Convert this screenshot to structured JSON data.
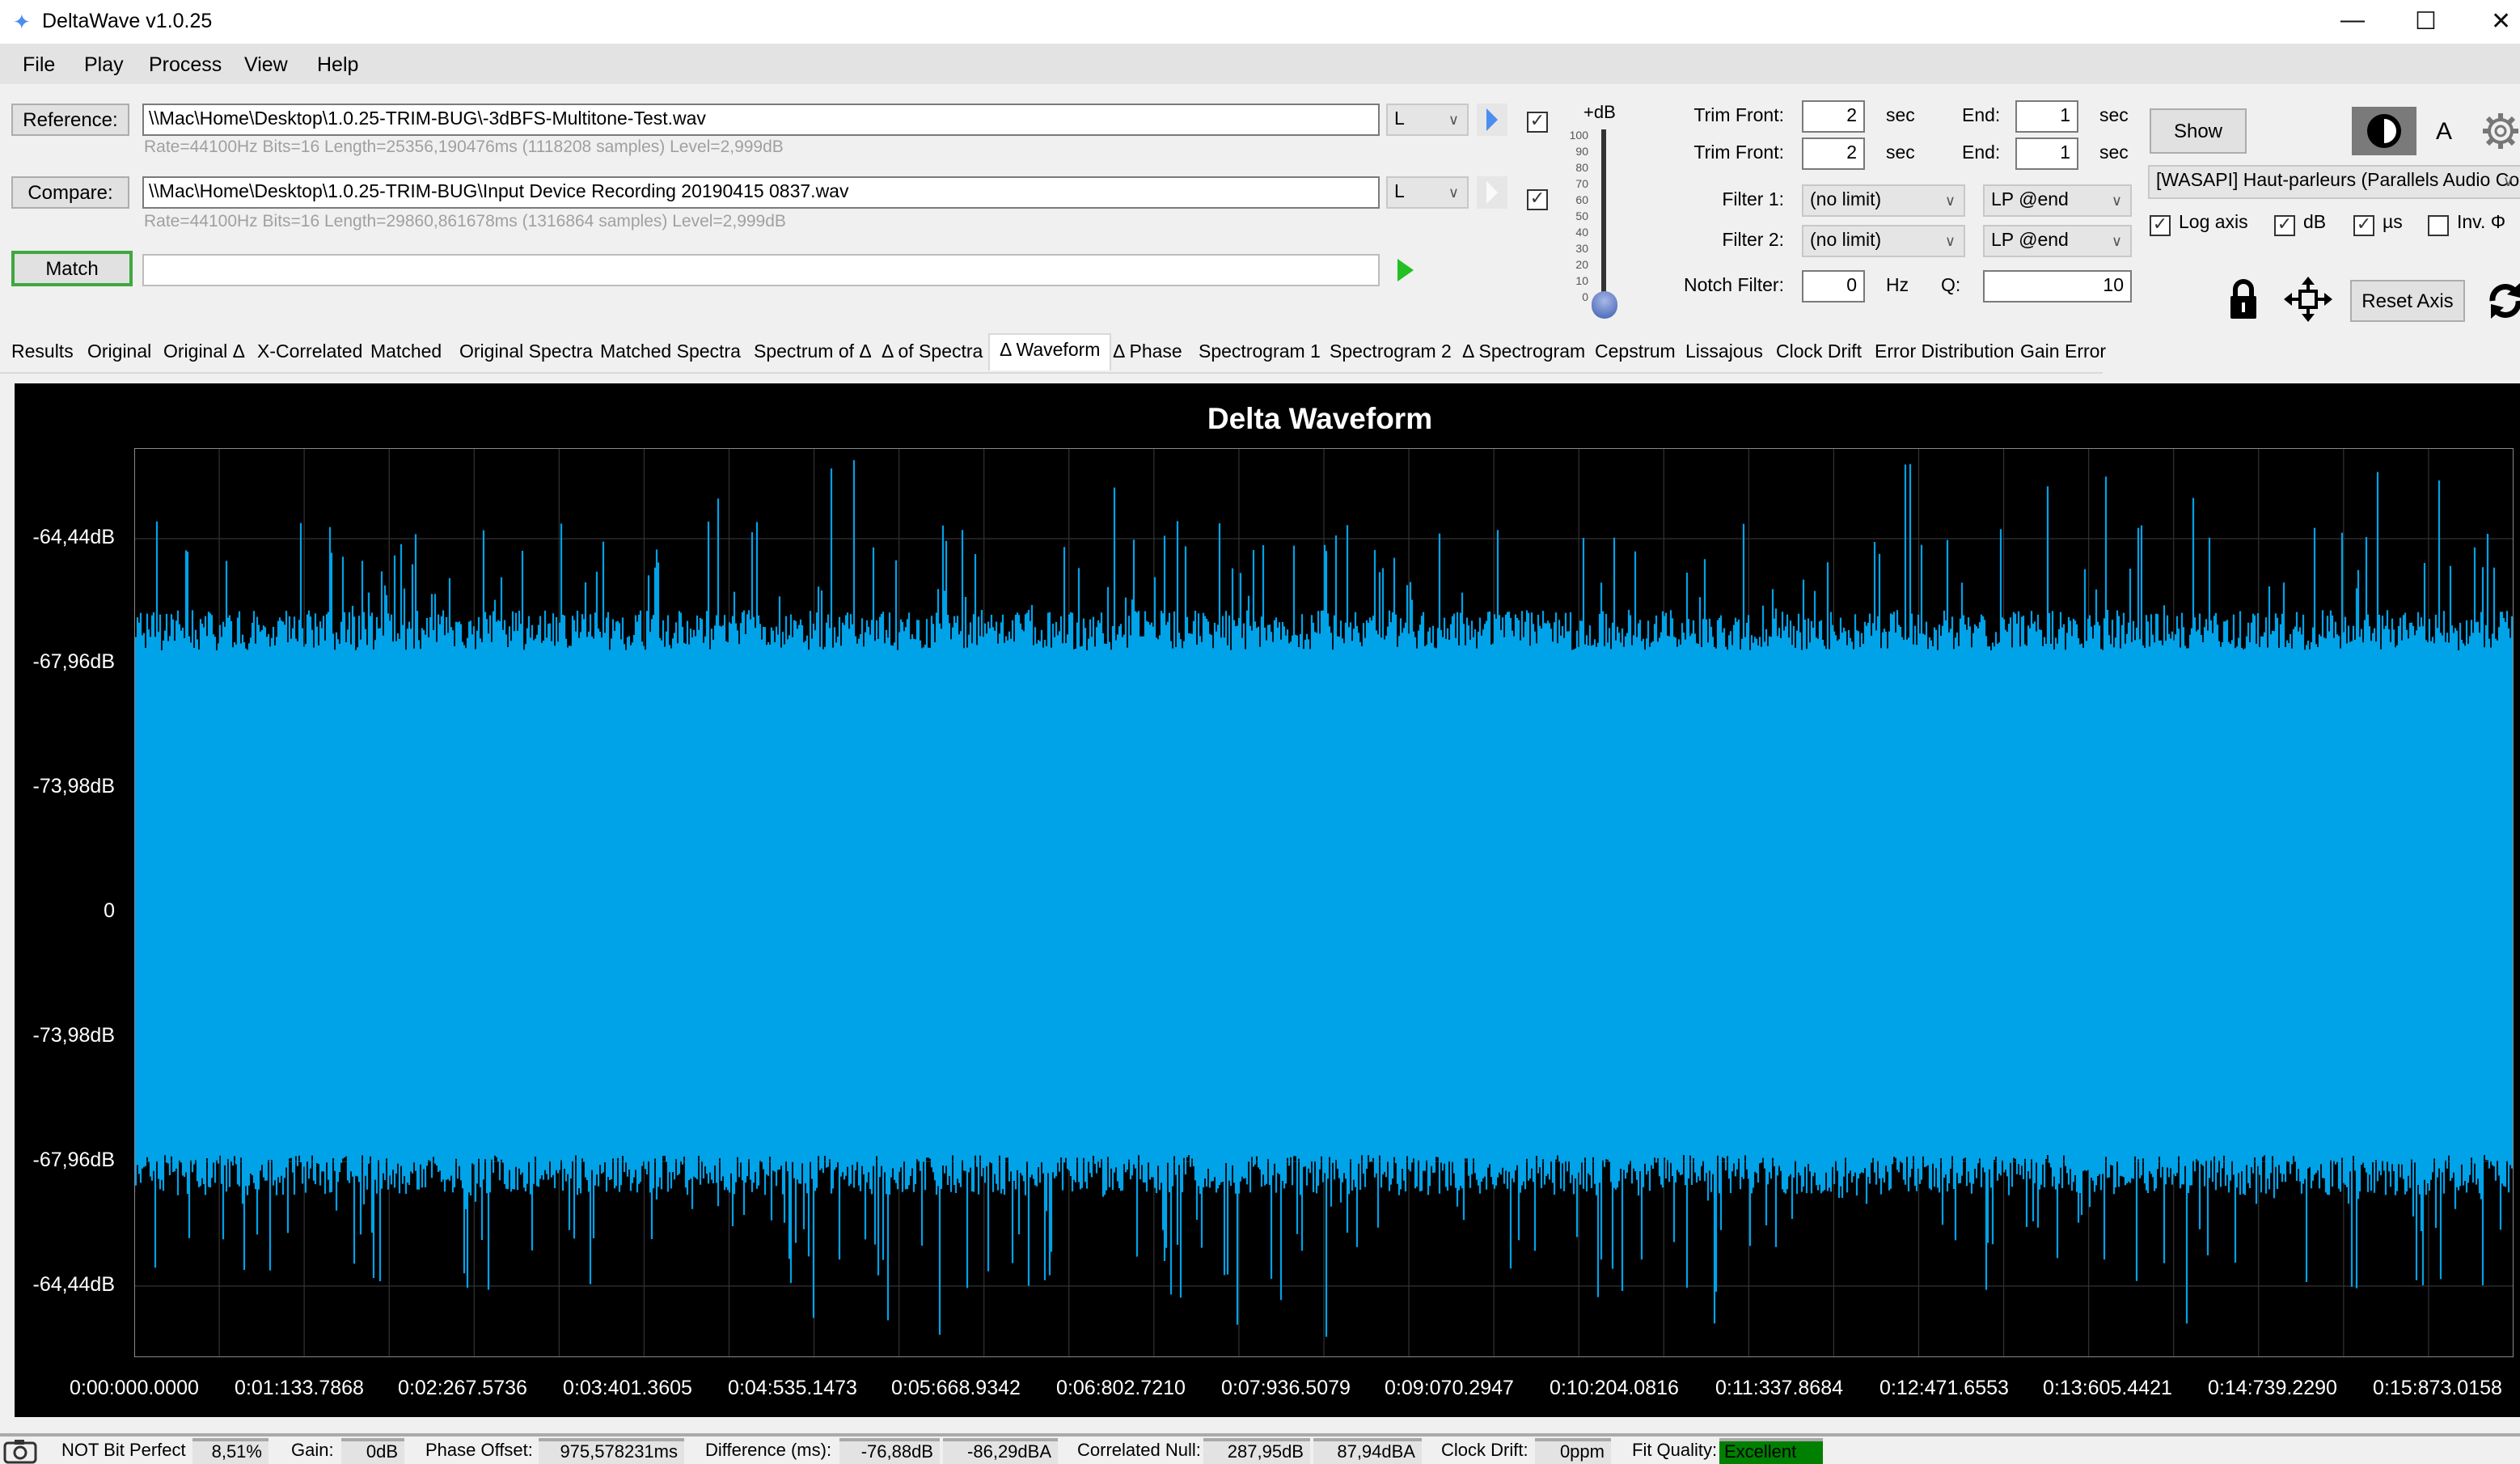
{
  "window": {
    "title": "DeltaWave v1.0.25"
  },
  "menu": [
    "File",
    "Play",
    "Process",
    "View",
    "Help"
  ],
  "reference": {
    "button": "Reference:",
    "path": "\\\\Mac\\Home\\Desktop\\1.0.25-TRIM-BUG\\-3dBFS-Multitone-Test.wav",
    "channel": "L",
    "info": "Rate=44100Hz Bits=16 Length=25356,190476ms (1118208 samples) Level=2,999dB",
    "checked": true
  },
  "compare": {
    "button": "Compare:",
    "path": "\\\\Mac\\Home\\Desktop\\1.0.25-TRIM-BUG\\Input Device Recording 20190415 0837.wav",
    "channel": "L",
    "info": "Rate=44100Hz Bits=16 Length=29860,861678ms (1316864 samples) Level=2,999dB",
    "checked": true
  },
  "match": {
    "button": "Match",
    "progress": ""
  },
  "slider": {
    "label": "+dB",
    "ticks": [
      "100",
      "90",
      "80",
      "70",
      "60",
      "50",
      "40",
      "30",
      "20",
      "10",
      "0"
    ],
    "value": 0
  },
  "trim": {
    "front_label": "Trim Front:",
    "end_label": "End:",
    "unit": "sec",
    "ref_front": "2",
    "ref_end": "1",
    "cmp_front": "2",
    "cmp_end": "1"
  },
  "filters": {
    "f1_label": "Filter 1:",
    "f1_value": "(no limit)",
    "f1_mode": "LP @end",
    "f2_label": "Filter 2:",
    "f2_value": "(no limit)",
    "f2_mode": "LP @end"
  },
  "notch": {
    "label": "Notch Filter:",
    "value": "0",
    "unit": "Hz",
    "q_label": "Q:",
    "q_value": "10"
  },
  "right": {
    "show": "Show",
    "a_label": "A",
    "device": "[WASAPI] Haut-parleurs (Parallels Audio Cor",
    "reset_axis": "Reset Axis"
  },
  "options": [
    {
      "label": "Log axis",
      "checked": true
    },
    {
      "label": "dB",
      "checked": true
    },
    {
      "label": "µs",
      "checked": true
    },
    {
      "label": "Inv. Φ",
      "checked": false
    }
  ],
  "tabs": [
    "Results",
    "Original",
    "Original Δ",
    "X-Correlated",
    "Matched",
    "Original Spectra",
    "Matched Spectra",
    "Spectrum of Δ",
    "Δ of Spectra",
    "Δ Waveform",
    "Δ Phase",
    "Spectrogram 1",
    "Spectrogram 2",
    "Δ Spectrogram",
    "Cepstrum",
    "Lissajous",
    "Clock Drift",
    "Error Distribution",
    "Gain Error"
  ],
  "active_tab": "Δ Waveform",
  "chart_data": {
    "type": "line",
    "title": "Delta Waveform",
    "y_ticks": [
      "-64,44dB",
      "-67,96dB",
      "-73,98dB",
      "0",
      "-73,98dB",
      "-67,96dB",
      "-64,44dB"
    ],
    "x_ticks": [
      "0:00:000.0000",
      "0:01:133.7868",
      "0:02:267.5736",
      "0:03:401.3605",
      "0:04:535.1473",
      "0:05:668.9342",
      "0:06:802.7210",
      "0:07:936.5079",
      "0:09:070.2947",
      "0:10:204.0816",
      "0:11:337.8684",
      "0:12:471.6553",
      "0:13:605.4421",
      "0:14:739.2290",
      "0:15:873.0158"
    ],
    "series_color": "#00a2e8",
    "background": "#000000",
    "grid": true
  },
  "status": {
    "bit_perfect": "NOT Bit Perfect",
    "bit_perfect_value": "8,51%",
    "gain_label": "Gain:",
    "gain": "0dB",
    "phase_label": "Phase Offset:",
    "phase": "975,578231ms",
    "diff_label": "Difference (ms):",
    "diff_db": "-76,88dB",
    "diff_dba": "-86,29dBA",
    "null_label": "Correlated Null:",
    "null_db": "287,95dB",
    "null_dba": "87,94dBA",
    "drift_label": "Clock Drift:",
    "drift": "0ppm",
    "fit_label": "Fit Quality:",
    "fit": "Excellent",
    "fit_color": "#008000"
  }
}
